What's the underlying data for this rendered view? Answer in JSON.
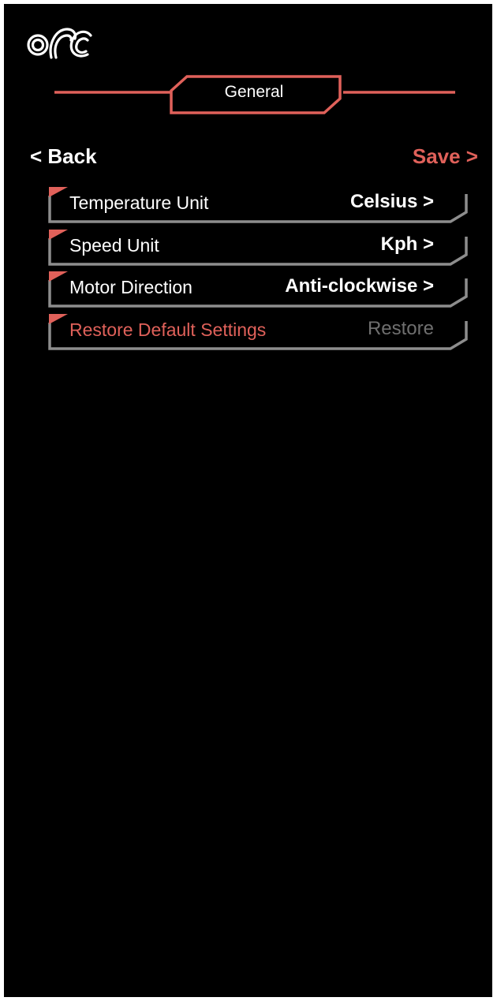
{
  "colors": {
    "accent": "#e0615a",
    "border": "#8d8d8d",
    "background": "#000000",
    "text": "#ffffff",
    "disabled": "#6f6f6f"
  },
  "header": {
    "title": "General"
  },
  "nav": {
    "back_label": "< Back",
    "save_label": "Save >"
  },
  "settings": [
    {
      "label": "Temperature  Unit",
      "value": "Celsius >"
    },
    {
      "label": "Speed  Unit",
      "value": "Kph >"
    },
    {
      "label": "Motor Direction",
      "value": "Anti-clockwise >"
    },
    {
      "label": "Restore Default Settings",
      "value": "Restore"
    }
  ]
}
